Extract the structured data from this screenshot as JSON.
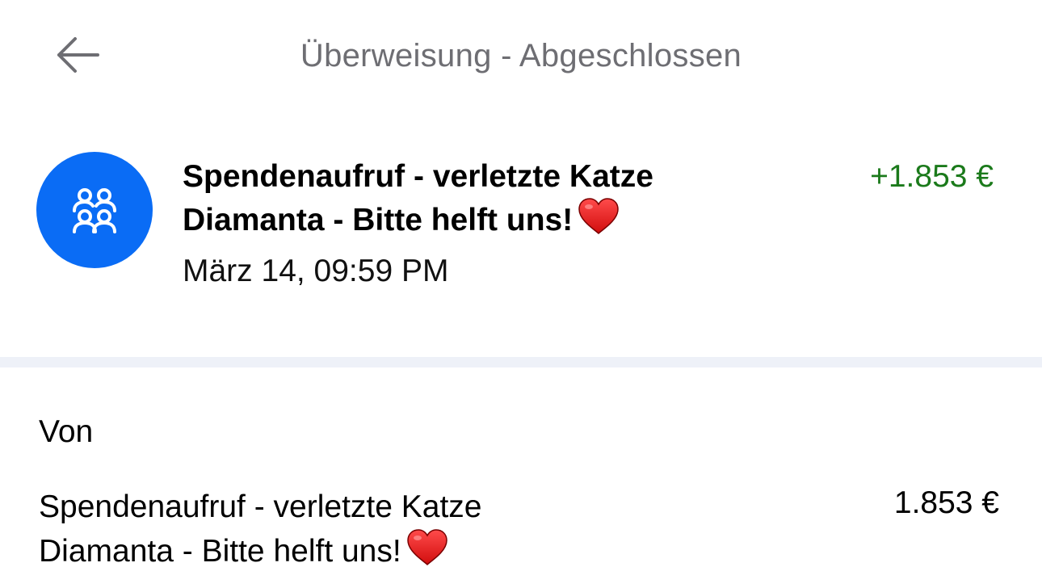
{
  "header": {
    "title": "Überweisung - Abgeschlossen",
    "back_icon": "arrow-left-icon"
  },
  "summary": {
    "avatar_icon": "group-people-icon",
    "avatar_color": "#0a6cf5",
    "title": "Spendenaufruf - verletzte Katze Diamanta - Bitte helft uns!",
    "title_emoji": "❤️",
    "amount": "+1.853 €",
    "amount_color": "#1b7a1b",
    "date": "März 14, 09:59 PM"
  },
  "details": {
    "from_label": "Von",
    "from_name": "Spendenaufruf - verletzte Katze Diamanta - Bitte helft uns!",
    "from_emoji": "❤️",
    "from_amount": "1.853 €"
  }
}
